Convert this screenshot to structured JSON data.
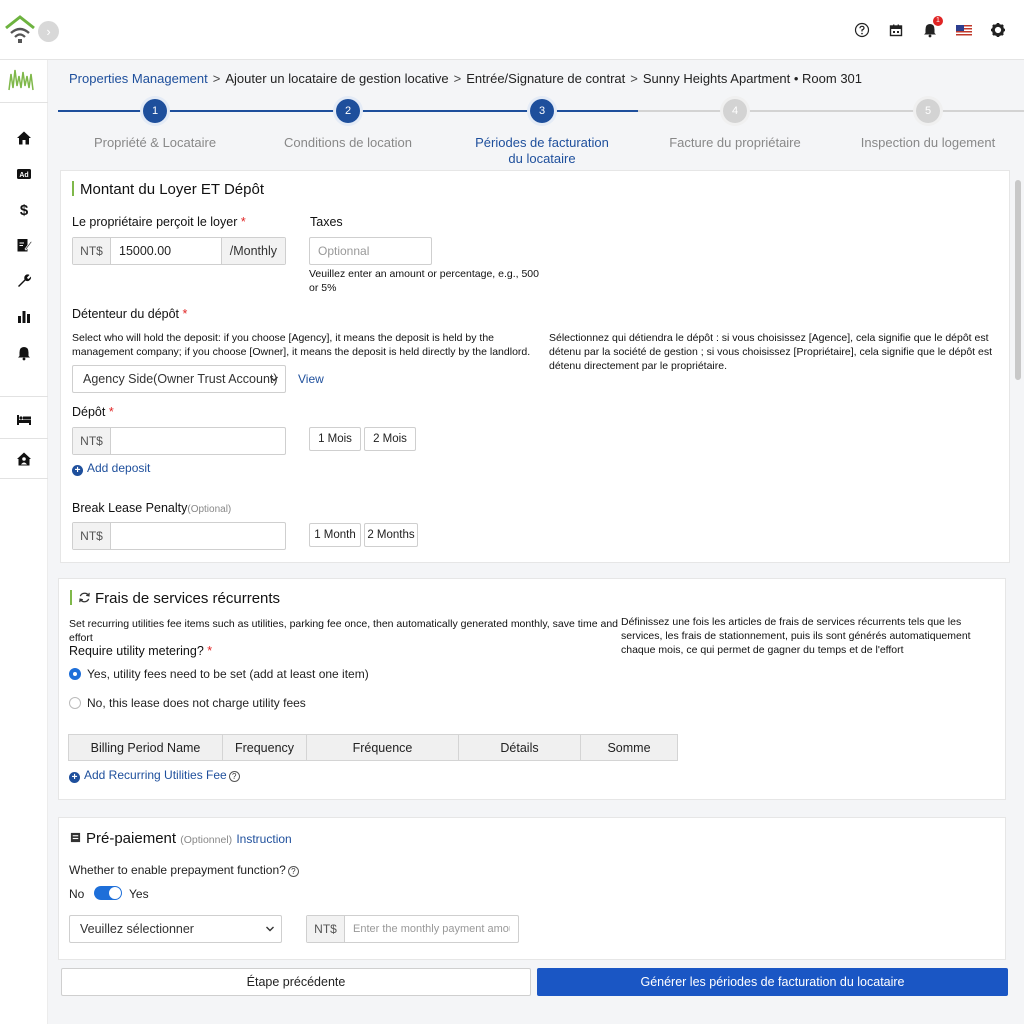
{
  "header": {
    "icons": [
      "help-icon",
      "calendar-icon",
      "bell-icon",
      "us-flag-icon",
      "gear-icon"
    ],
    "notification_count": "1"
  },
  "sidebar": {
    "icons": [
      "home-icon",
      "ad-icon",
      "dollar-icon",
      "contract-sign-icon",
      "wrench-icon",
      "bar-chart-icon",
      "bell-icon",
      "bed-icon",
      "house-person-icon"
    ]
  },
  "breadcrumb": {
    "items": [
      "Properties Management",
      "Ajouter un locataire de gestion locative",
      "Entrée/Signature de contrat",
      "Sunny Heights Apartment • Room 301"
    ],
    "separator": ">"
  },
  "stepper": {
    "steps": [
      {
        "number": "1",
        "label": "Propriété & Locataire",
        "state": "done"
      },
      {
        "number": "2",
        "label": "Conditions de location",
        "state": "done"
      },
      {
        "number": "3",
        "label": "Périodes de facturation du locataire",
        "state": "active"
      },
      {
        "number": "4",
        "label": "Facture du propriétaire",
        "state": "pending"
      },
      {
        "number": "5",
        "label": "Inspection du logement",
        "state": "pending"
      }
    ]
  },
  "rent_section": {
    "title": "Montant du Loyer ET Dépôt",
    "rent_label": "Le propriétaire perçoit le loyer",
    "required_mark": "*",
    "currency": "NT$",
    "rent_value": "15000.00",
    "rent_period": "/Monthly",
    "taxes_label": "Taxes",
    "taxes_placeholder": "Optionnal",
    "taxes_hint": "Veuillez enter an amount or percentage, e.g., 500 or 5%",
    "holder_label": "Détenteur du dépôt",
    "holder_desc_en": "Select who will hold the deposit: if you choose [Agency], it means the deposit is held by the management company; if you choose [Owner], it means the deposit is held directly by the landlord.",
    "holder_desc_fr": "Sélectionnez qui détiendra le dépôt : si vous choisissez [Agence], cela signifie que le dépôt est détenu par la société de gestion ; si vous choisissez [Propriétaire], cela signifie que le dépôt est détenu directement par le propriétaire.",
    "holder_selected": "Agency Side(Owner Trust Account)",
    "view_link": "View",
    "deposit_label": "Dépôt",
    "deposit_btn_1": "1 Mois",
    "deposit_btn_2": "2 Mois",
    "add_deposit": "Add deposit",
    "penalty_label": "Break Lease Penalty",
    "penalty_optional": "(Optional)",
    "penalty_btn_1": "1 Month",
    "penalty_btn_2": "2 Months"
  },
  "utilities_section": {
    "title": "Frais de services récurrents",
    "desc_en": "Set recurring utilities fee items such as utilities, parking fee once, then automatically generated monthly, save time and effort",
    "desc_fr": "Définissez une fois les articles de frais de services récurrents tels que les services, les frais de stationnement, puis ils sont générés automatiquement chaque mois, ce qui permet de gagner du temps et de l'effort",
    "metering_label": "Require utility metering?",
    "option_yes": "Yes, utility fees need to be set (add at least one item)",
    "option_no": "No, this lease does not charge utility fees",
    "selected_option": "yes",
    "table_headers": [
      "Billing Period Name",
      "Frequency",
      "Fréquence",
      "Détails",
      "Somme"
    ],
    "add_fee": "Add Recurring Utilities Fee"
  },
  "prepayment_section": {
    "title": "Pré-paiement",
    "optional": "(Optionnel)",
    "instruction_link": "Instruction",
    "question": "Whether to enable prepayment function?",
    "toggle_no": "No",
    "toggle_yes": "Yes",
    "toggle_on": true,
    "select_placeholder": "Veuillez sélectionner",
    "amount_placeholder": "Enter the monthly payment amount"
  },
  "footer": {
    "prev_button": "Étape précédente",
    "next_button": "Générer les périodes de facturation du locataire"
  },
  "colors": {
    "primary": "#1e4f9c",
    "button_primary": "#1a56c4",
    "step_done": "#1e4f9c",
    "step_pending": "#d3d3d3",
    "accent_green": "#7fb84a",
    "required": "#e02424"
  }
}
